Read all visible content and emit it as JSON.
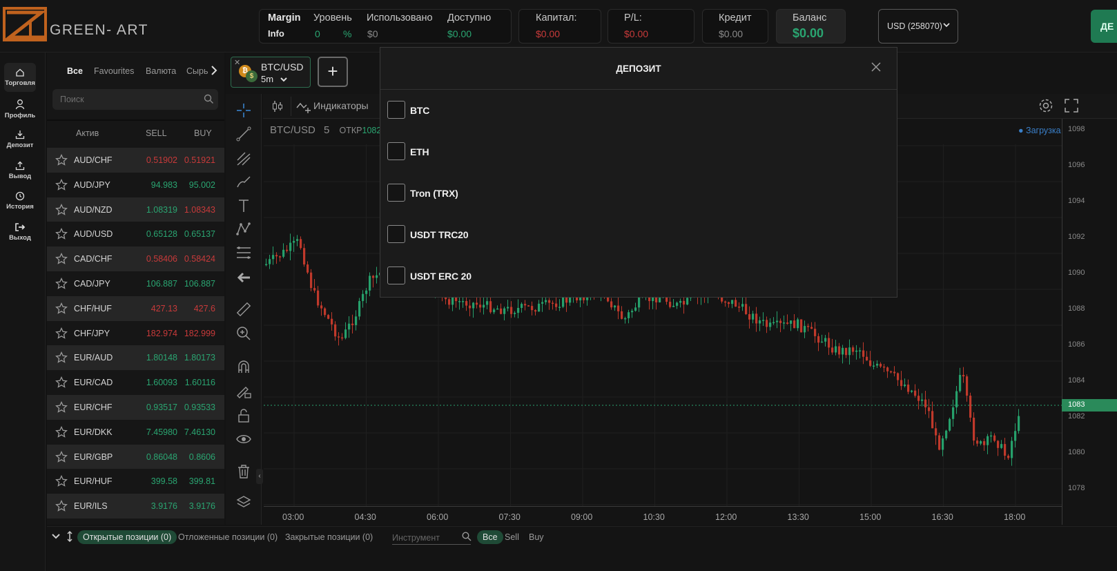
{
  "brand": {
    "name": "GREEN- ART"
  },
  "header": {
    "margin_label": "Margin",
    "info_label": "Info",
    "level_label": "Уровень",
    "level_value": "0",
    "level_unit": "%",
    "used_label": "Использовано",
    "used_value": "$0",
    "available_label": "Доступно",
    "available_value": "$0.00",
    "capital_label": "Капитал:",
    "capital_value": "$0.00",
    "pl_label": "P/L:",
    "pl_value": "$0.00",
    "credit_label": "Кредит",
    "credit_value": "$0.00",
    "balance_label": "Баланс",
    "balance_value": "$0.00",
    "account_select": "USD (258070)",
    "deposit_button": "ДЕ"
  },
  "leftnav": [
    {
      "label": "Торговля",
      "icon": "home-icon"
    },
    {
      "label": "Профиль",
      "icon": "user-icon"
    },
    {
      "label": "Депозит",
      "icon": "download-icon"
    },
    {
      "label": "Вывод",
      "icon": "upload-icon"
    },
    {
      "label": "История",
      "icon": "clock-icon"
    },
    {
      "label": "Выход",
      "icon": "logout-icon"
    }
  ],
  "assets": {
    "tabs": [
      "Все",
      "Favourites",
      "Валюта",
      "Сырь"
    ],
    "search_placeholder": "Поиск",
    "columns": {
      "asset": "Актив",
      "sell": "SELL",
      "buy": "BUY"
    },
    "rows": [
      {
        "symbol": "AUD/CHF",
        "sell": "0.51902",
        "buy": "0.51921",
        "color": "red"
      },
      {
        "symbol": "AUD/JPY",
        "sell": "94.983",
        "buy": "95.002",
        "color": "green"
      },
      {
        "symbol": "AUD/NZD",
        "sell": "1.08319",
        "buy": "1.08343",
        "color": "mixed"
      },
      {
        "symbol": "AUD/USD",
        "sell": "0.65128",
        "buy": "0.65137",
        "color": "green"
      },
      {
        "symbol": "CAD/CHF",
        "sell": "0.58406",
        "buy": "0.58424",
        "color": "red"
      },
      {
        "symbol": "CAD/JPY",
        "sell": "106.887",
        "buy": "106.887",
        "color": "green"
      },
      {
        "symbol": "CHF/HUF",
        "sell": "427.13",
        "buy": "427.6",
        "color": "red"
      },
      {
        "symbol": "CHF/JPY",
        "sell": "182.974",
        "buy": "182.999",
        "color": "red"
      },
      {
        "symbol": "EUR/AUD",
        "sell": "1.80148",
        "buy": "1.80173",
        "color": "green"
      },
      {
        "symbol": "EUR/CAD",
        "sell": "1.60093",
        "buy": "1.60116",
        "color": "green"
      },
      {
        "symbol": "EUR/CHF",
        "sell": "0.93517",
        "buy": "0.93533",
        "color": "green"
      },
      {
        "symbol": "EUR/DKK",
        "sell": "7.45980",
        "buy": "7.46130",
        "color": "green"
      },
      {
        "symbol": "EUR/GBP",
        "sell": "0.86048",
        "buy": "0.8606",
        "color": "green"
      },
      {
        "symbol": "EUR/HUF",
        "sell": "399.58",
        "buy": "399.81",
        "color": "green"
      },
      {
        "symbol": "EUR/ILS",
        "sell": "3.9176",
        "buy": "3.9176",
        "color": "green"
      }
    ]
  },
  "chart": {
    "ticket_pair": "BTC/USD",
    "ticket_timeframe": "5m",
    "add_label": "+",
    "indicators_label": "Индикаторы",
    "title_pair": "BTC/USD",
    "title_tf": "5",
    "title_open_label": "ОТКР",
    "title_open_value": "1082",
    "loading_label": "● Загрузка",
    "price_labels": [
      "1098",
      "1096",
      "1094",
      "1092",
      "1090",
      "1088",
      "1086",
      "1084",
      "1082",
      "1080",
      "1078"
    ],
    "current_price": "1083",
    "time_labels": [
      "03:00",
      "04:30",
      "06:00",
      "07:30",
      "09:00",
      "10:30",
      "12:00",
      "13:30",
      "15:00",
      "16:30",
      "18:00"
    ]
  },
  "bottom": {
    "open_positions": "Открытые позиции (0)",
    "pending_positions": "Отложенные позиции (0)",
    "closed_positions": "Закрытые позиции (0)",
    "instrument_placeholder": "Инструмент",
    "filter_all": "Все",
    "filter_sell": "Sell",
    "filter_buy": "Buy"
  },
  "modal": {
    "title": "ДЕПОЗИТ",
    "options": [
      "BTC",
      "ETH",
      "Tron (TRX)",
      "USDT TRC20",
      "USDT ERC 20"
    ]
  },
  "colors": {
    "accent": "#2aa571",
    "negative": "#c83a3a",
    "deposit_button": "#1f7a52"
  }
}
